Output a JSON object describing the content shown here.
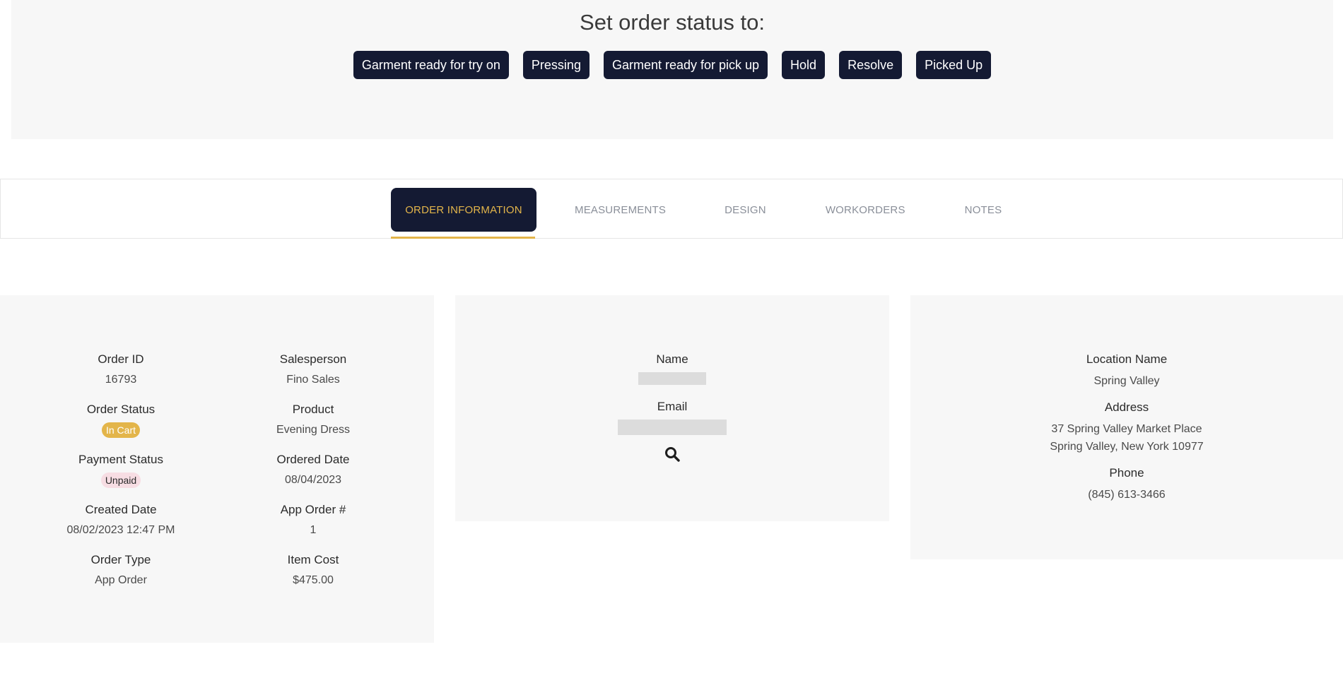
{
  "status_panel": {
    "title": "Set order status to:",
    "buttons": [
      "Garment ready for try on",
      "Pressing",
      "Garment ready for pick up",
      "Hold",
      "Resolve",
      "Picked Up"
    ]
  },
  "tabs": [
    {
      "label": "ORDER INFORMATION",
      "active": true
    },
    {
      "label": "MEASUREMENTS",
      "active": false
    },
    {
      "label": "DESIGN",
      "active": false
    },
    {
      "label": "WORKORDERS",
      "active": false
    },
    {
      "label": "NOTES",
      "active": false
    }
  ],
  "order": {
    "order_id_label": "Order ID",
    "order_id": "16793",
    "order_status_label": "Order Status",
    "order_status": "In Cart",
    "payment_status_label": "Payment Status",
    "payment_status": "Unpaid",
    "created_date_label": "Created Date",
    "created_date": "08/02/2023 12:47 PM",
    "order_type_label": "Order Type",
    "order_type": "App Order",
    "salesperson_label": "Salesperson",
    "salesperson": "Fino Sales",
    "product_label": "Product",
    "product": "Evening Dress",
    "ordered_date_label": "Ordered Date",
    "ordered_date": "08/04/2023",
    "app_order_label": "App Order #",
    "app_order": "1",
    "item_cost_label": "Item Cost",
    "item_cost": "$475.00"
  },
  "customer": {
    "name_label": "Name",
    "email_label": "Email",
    "search_icon": "search-icon"
  },
  "location": {
    "name_label": "Location Name",
    "name": "Spring Valley",
    "address_label": "Address",
    "address_line1": "37 Spring Valley Market Place",
    "address_line2": "Spring Valley, New York 10977",
    "phone_label": "Phone",
    "phone": "(845) 613-3466"
  },
  "colors": {
    "navy": "#141a33",
    "gold": "#e3b54a",
    "panel": "#f7f7f7",
    "unpaid_badge": "#f7dde3"
  }
}
